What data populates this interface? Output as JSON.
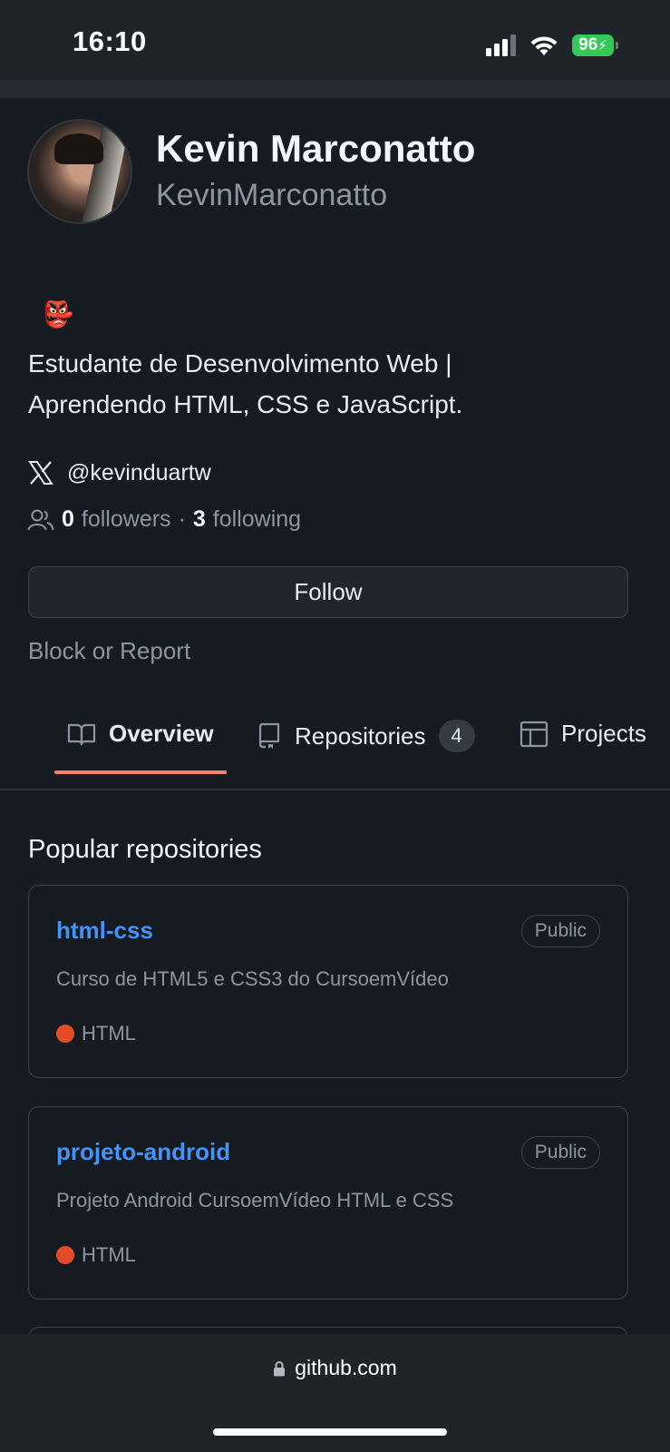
{
  "status_bar": {
    "time": "16:10",
    "battery": "96"
  },
  "profile": {
    "name": "Kevin Marconatto",
    "login": "KevinMarconatto",
    "status_emoji": "👺",
    "bio_lines": [
      "Estudante de Desenvolvimento Web |",
      "Aprendendo HTML, CSS e JavaScript."
    ],
    "social_handle": "@kevinduartw",
    "followers_count": "0",
    "followers_label": "followers",
    "separator": "·",
    "following_count": "3",
    "following_label": "following",
    "follow_button": "Follow",
    "block_link": "Block or Report"
  },
  "tabs": [
    {
      "label": "Overview",
      "icon": "book-icon",
      "active": true
    },
    {
      "label": "Repositories",
      "icon": "repo-icon",
      "count": "4"
    },
    {
      "label": "Projects",
      "icon": "table-icon"
    }
  ],
  "popular": {
    "title": "Popular repositories",
    "repos": [
      {
        "name": "html-css",
        "visibility": "Public",
        "description": "Curso de HTML5 e CSS3 do CursoemVídeo",
        "language": "HTML",
        "language_color": "#e34c26"
      },
      {
        "name": "projeto-android",
        "visibility": "Public",
        "description": "Projeto Android CursoemVídeo HTML e CSS",
        "language": "HTML",
        "language_color": "#e34c26"
      }
    ]
  },
  "browser": {
    "url": "github.com"
  },
  "colors": {
    "link": "#4493f8",
    "tab_underline": "#f78166",
    "battery": "#34c759"
  }
}
